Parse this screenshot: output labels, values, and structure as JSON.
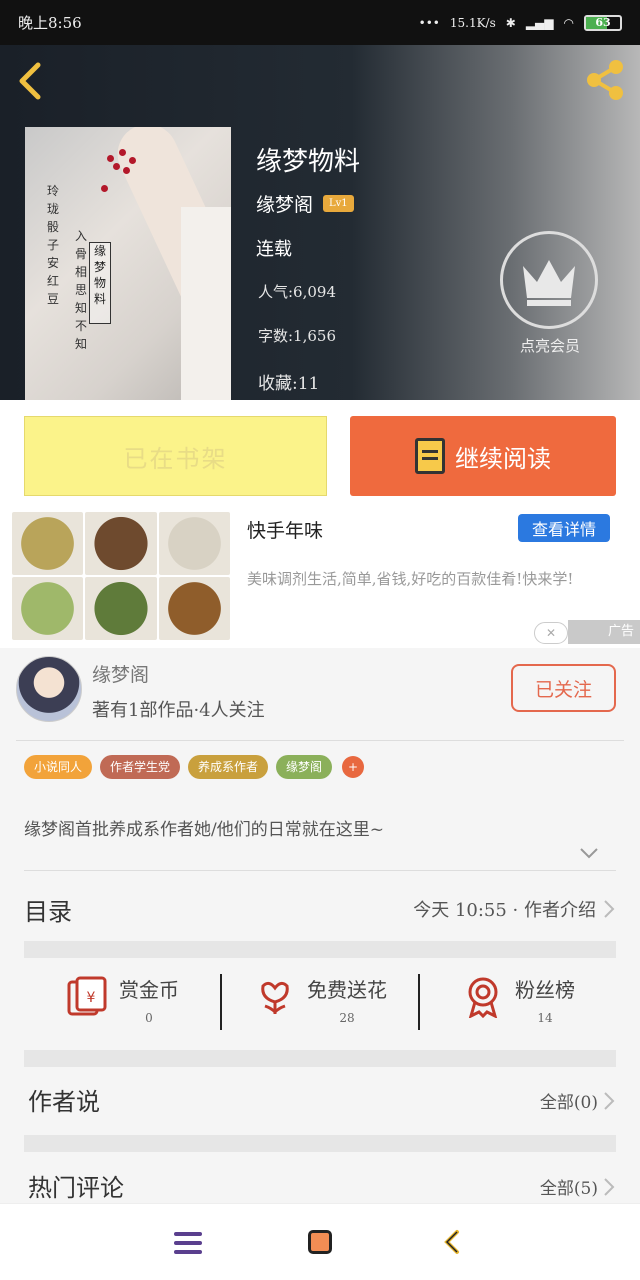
{
  "status_bar": {
    "time": "晚上8:56",
    "network_speed": "15.1K/s",
    "battery": "63",
    "battery_level": 63
  },
  "book": {
    "title": "缘梦物料",
    "author": "缘梦阁",
    "level": "Lv1",
    "state": "连载",
    "popularity": "人气:6,094",
    "words": "字数:1,656",
    "favorites": "收藏:11",
    "vip_label": "点亮会员",
    "cover_poem_1": "玲珑骰子安红豆",
    "cover_poem_2": "入骨相思知不知",
    "cover_stamp": "缘梦物料"
  },
  "actions": {
    "shelf_label": "已在书架",
    "read_label": "继续阅读"
  },
  "ad": {
    "title": "快手年味",
    "detail_label": "查看详情",
    "description": "美味调剂生活,简单,省钱,好吃的百款佳肴!快来学!",
    "close_label": "✕",
    "tag": "广告",
    "photo_colors": [
      "#b9a45a",
      "#6e4a2e",
      "#d8d2c4",
      "#9fb86a",
      "#5f7b3a",
      "#8f5d2b"
    ]
  },
  "author": {
    "name": "缘梦阁",
    "stats": "著有1部作品·4人关注",
    "follow_label": "已关注",
    "tags": [
      {
        "label": "小说同人",
        "color": "#f2a33a"
      },
      {
        "label": "作者学生党",
        "color": "#c06a55"
      },
      {
        "label": "养成系作者",
        "color": "#c9a03d"
      },
      {
        "label": "缘梦阁",
        "color": "#8bb05a"
      }
    ],
    "tag_more": "+",
    "intro": "缘梦阁首批养成系作者她/他们的日常就在这里~"
  },
  "catalog": {
    "title": "目录",
    "info": "今天 10:55 · 作者介绍"
  },
  "stats": [
    {
      "name": "赏金币",
      "value": "0",
      "icon": "red-envelope-icon"
    },
    {
      "name": "免费送花",
      "value": "28",
      "icon": "flower-icon"
    },
    {
      "name": "粉丝榜",
      "value": "14",
      "icon": "medal-icon"
    }
  ],
  "author_say": {
    "title": "作者说",
    "link": "全部(0)"
  },
  "hot_comments": {
    "title": "热门评论",
    "link": "全部(5)"
  },
  "colors": {
    "accent": "#ef6a3e",
    "shelf": "#fbf38a",
    "link_blue": "#2b79e0"
  }
}
